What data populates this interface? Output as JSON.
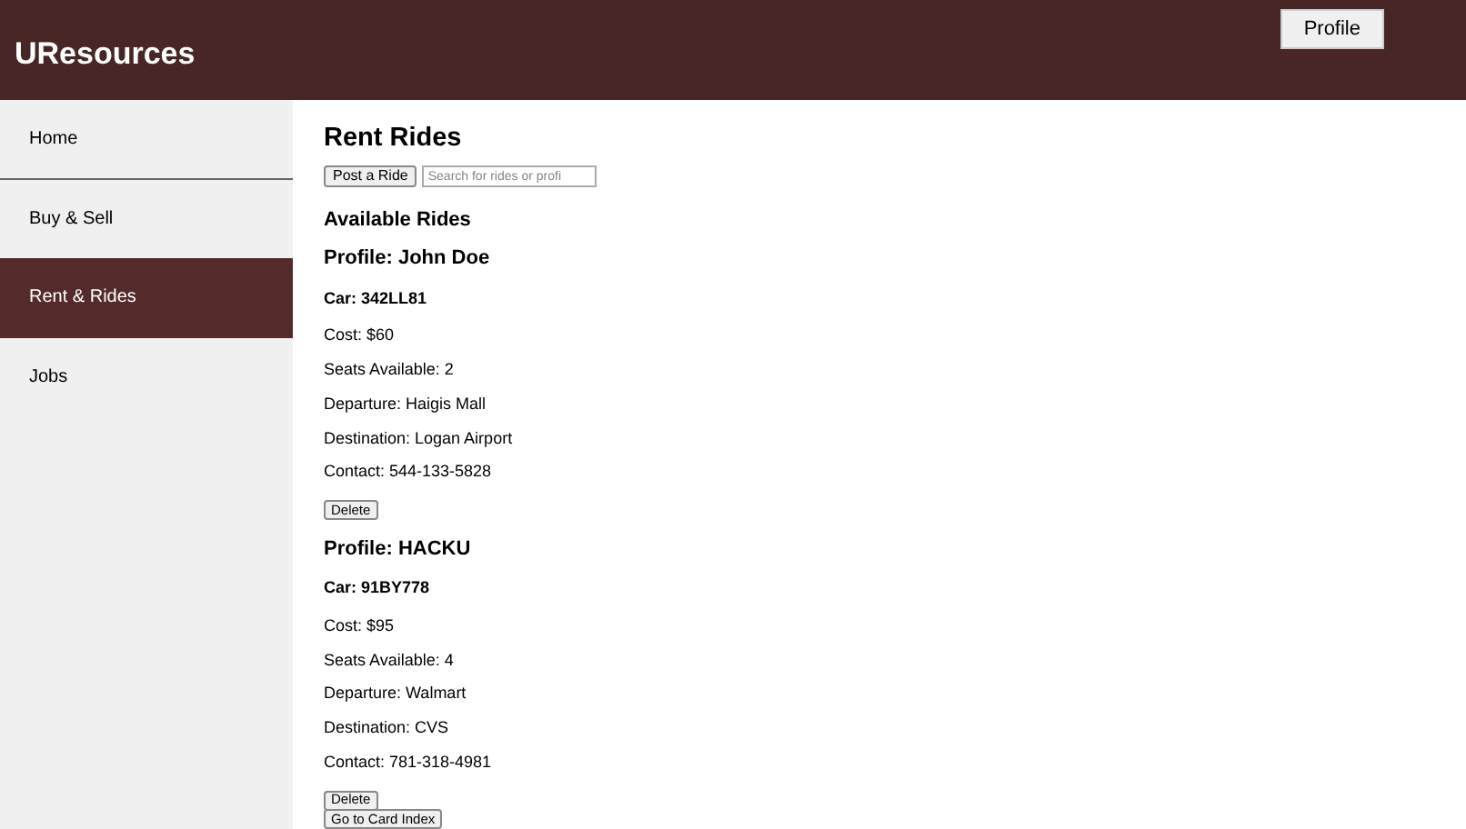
{
  "header": {
    "title": "UResources",
    "profile_button": "Profile"
  },
  "sidebar": {
    "items": [
      {
        "label": "Home",
        "selected": false
      },
      {
        "label": "Buy & Sell",
        "selected": false
      },
      {
        "label": "Rent & Rides",
        "selected": true
      },
      {
        "label": "Jobs",
        "selected": false
      }
    ]
  },
  "main": {
    "title": "Rent Rides",
    "post_button": "Post a Ride",
    "search": {
      "placeholder": "Search for rides or profi"
    },
    "section_title": "Available Rides",
    "rides": [
      {
        "profile": "Profile: John Doe",
        "car": "Car: 342LL81",
        "details": [
          "Cost: $60",
          "Seats Available: 2",
          "Departure: Haigis Mall",
          "Destination: Logan Airport",
          "Contact: 544-133-5828"
        ],
        "delete_button": "Delete"
      },
      {
        "profile": "Profile: HACKU",
        "car": "Car: 91BY778",
        "details": [
          "Cost: $95",
          "Seats Available: 4",
          "Departure: Walmart",
          "Destination: CVS",
          "Contact: 781-318-4981"
        ],
        "delete_button": "Delete"
      }
    ],
    "footer_button": "Go to Card Index"
  }
}
